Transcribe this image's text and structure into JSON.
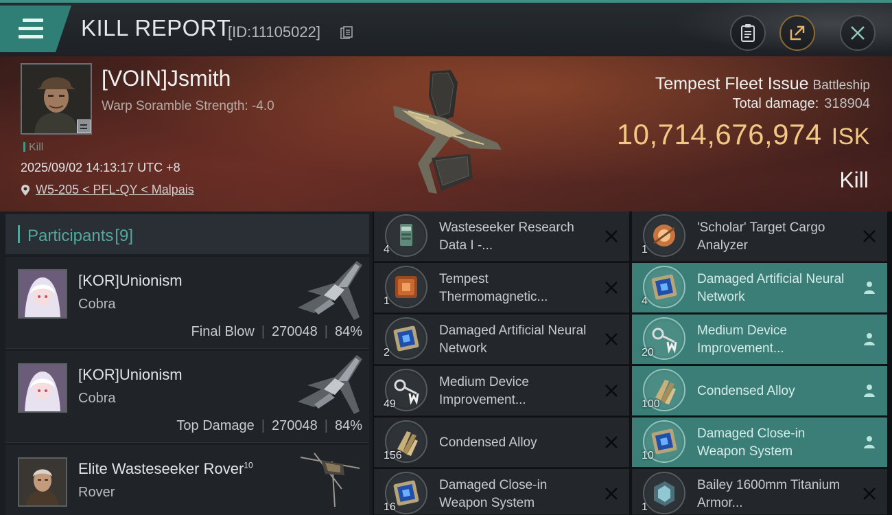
{
  "header": {
    "title": "KILL REPORT",
    "report_id": "[ID:11105022]"
  },
  "victim": {
    "name": "[VOIN]Jsmith",
    "scramble": "Warp Soramble Strength: -4.0",
    "tag": "Kill",
    "datetime": "2025/09/02 14:13:17 UTC +8",
    "location": "W5-205 < PFL-QY < Malpais",
    "ship_name": "Tempest Fleet Issue",
    "ship_class": "Battleship",
    "total_damage_label": "Total damage:",
    "total_damage": "318904",
    "isk_value": "10,714,676,974",
    "isk_unit": "ISK",
    "status": "Kill"
  },
  "participants": {
    "label": "Participants",
    "count": "[9]",
    "rows": [
      {
        "name": "[KOR]Unionism",
        "level": "",
        "ship": "Cobra",
        "role": "Final Blow",
        "damage": "270048",
        "percent": "84%"
      },
      {
        "name": "[KOR]Unionism",
        "level": "",
        "ship": "Cobra",
        "role": "Top Damage",
        "damage": "270048",
        "percent": "84%"
      },
      {
        "name": "Elite Wasteseeker Rover",
        "level": "10",
        "ship": "Rover",
        "role": "",
        "damage": "",
        "percent": ""
      }
    ]
  },
  "items": [
    {
      "qty": "4",
      "name": "Wasteseeker Research Data I -...",
      "status": "destroyed",
      "icon": "data-chip-icon"
    },
    {
      "qty": "1",
      "name": "'Scholar' Target Cargo Analyzer",
      "status": "destroyed",
      "icon": "analyzer-orb-icon"
    },
    {
      "qty": "1",
      "name": "Tempest Thermomagnetic...",
      "status": "destroyed",
      "icon": "bpc-copper-icon"
    },
    {
      "qty": "4",
      "name": "Damaged Artificial Neural Network",
      "status": "dropped",
      "icon": "neural-chip-icon"
    },
    {
      "qty": "2",
      "name": "Damaged Artificial Neural Network",
      "status": "destroyed",
      "icon": "neural-chip-icon"
    },
    {
      "qty": "20",
      "name": "Medium Device Improvement...",
      "status": "dropped",
      "icon": "device-key-icon"
    },
    {
      "qty": "49",
      "name": "Medium Device Improvement...",
      "status": "destroyed",
      "icon": "device-key-icon"
    },
    {
      "qty": "100",
      "name": "Condensed Alloy",
      "status": "dropped",
      "icon": "alloy-bars-icon"
    },
    {
      "qty": "156",
      "name": "Condensed Alloy",
      "status": "destroyed",
      "icon": "alloy-bars-icon"
    },
    {
      "qty": "10",
      "name": "Damaged Close-in Weapon System",
      "status": "dropped",
      "icon": "neural-chip-icon"
    },
    {
      "qty": "16",
      "name": "Damaged Close-in Weapon System",
      "status": "destroyed",
      "icon": "neural-chip-icon"
    },
    {
      "qty": "1",
      "name": "Bailey 1600mm Titanium Armor...",
      "status": "destroyed",
      "icon": "armor-plate-icon"
    }
  ],
  "colors": {
    "accent_teal": "#3f8f86",
    "isk_gold": "#f3c884",
    "dropped_bg": "#3a7e77",
    "destroyed_bg": "#23272b"
  }
}
